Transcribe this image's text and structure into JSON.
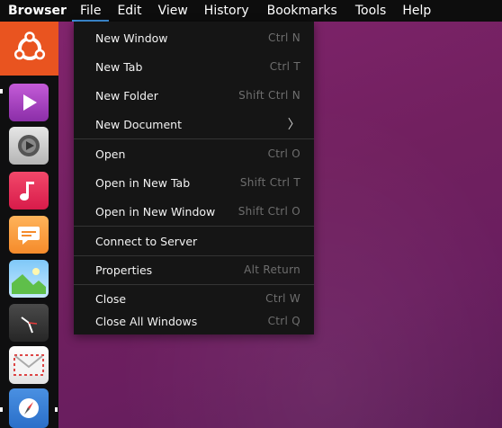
{
  "menubar": {
    "app_title": "Browser",
    "menus": [
      "File",
      "Edit",
      "View",
      "History",
      "Bookmarks",
      "Tools",
      "Help"
    ],
    "active_menu": "File"
  },
  "file_menu": {
    "items": [
      {
        "label": "New Window",
        "shortcut": "Ctrl  N"
      },
      {
        "label": "New Tab",
        "shortcut": "Ctrl  T"
      },
      {
        "label": "New Folder",
        "shortcut": "Shift  Ctrl  N"
      },
      {
        "label": "New Document",
        "shortcut": "〉"
      },
      {
        "label": "Open",
        "shortcut": "Ctrl  O"
      },
      {
        "label": "Open in New Tab",
        "shortcut": "Shift  Ctrl  T"
      },
      {
        "label": "Open in New Window",
        "shortcut": "Shift  Ctrl  O"
      },
      {
        "label": "Connect to Server",
        "shortcut": ""
      },
      {
        "label": "Properties",
        "shortcut": "Alt  Return"
      },
      {
        "label": "Close",
        "shortcut": "Ctrl  W"
      },
      {
        "label": "Close All Windows",
        "shortcut": "Ctrl  Q"
      }
    ]
  },
  "launcher": {
    "apps": [
      "ubuntu-logo",
      "video-player",
      "system-settings",
      "music",
      "messaging",
      "photos",
      "clock",
      "mail",
      "browser"
    ]
  },
  "colors": {
    "accent_underline": "#3d8fd9",
    "ubuntu_orange": "#e95420",
    "desktop": "#6e1f62",
    "menu_bg": "#151515"
  }
}
